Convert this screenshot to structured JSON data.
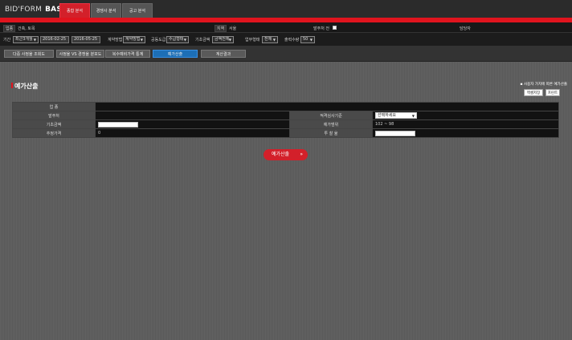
{
  "app": {
    "logo_a": "BID'FORM",
    "logo_b": "BAS"
  },
  "tabs": [
    {
      "label": "종합 분석",
      "active": true
    },
    {
      "label": "경쟁사 분석",
      "active": false
    },
    {
      "label": "공고 분석",
      "active": false
    }
  ],
  "filter_row1": {
    "category_label": "업종",
    "category_value": "건축, 토목",
    "region_label": "지역",
    "region_value": "서울",
    "agency_label": "발주처 전",
    "manager_label": "담당자"
  },
  "filter_row2": {
    "period_label": "기간",
    "period_select": "최근3개월",
    "date_from": "2016-02-25",
    "date_to": "2016-05-25",
    "contract_label": "계약방법",
    "contract_select": "계약방법",
    "grade_label": "공동도급",
    "grade_select": "수급형태",
    "base_label": "기초금액",
    "base_select": "금액전체",
    "status_label": "업무형태",
    "status_select": "전체",
    "count_label": "출력수량",
    "count_select": "50"
  },
  "action_buttons": [
    {
      "label": "다중 사정율 조회도"
    },
    {
      "label": "사정율 VS 경쟁율 분포도"
    },
    {
      "label": "복수예비가격 통계"
    },
    {
      "label": "예가산출",
      "active": true
    },
    {
      "label": "계산결과"
    }
  ],
  "section": {
    "title": "예가산출",
    "note": "▪ 사용자 가치에 따른 예가산출",
    "btn_excel": "엑셀저장",
    "btn_print": "프린트"
  },
  "grid": {
    "row1": {
      "h1": "업 종",
      "v1": ""
    },
    "row2": {
      "h1": "발주처",
      "v1": "",
      "h2": "적격심사기준",
      "select": "선택하세요"
    },
    "row3": {
      "h1": "기초금액",
      "h2": "예가범위",
      "v2": "102 ~ 98"
    },
    "row4": {
      "h1": "추정가격",
      "v1": "0",
      "h2": "투 찰 율"
    }
  },
  "calc_button": {
    "label": "예가산출",
    "arrows": "»"
  }
}
